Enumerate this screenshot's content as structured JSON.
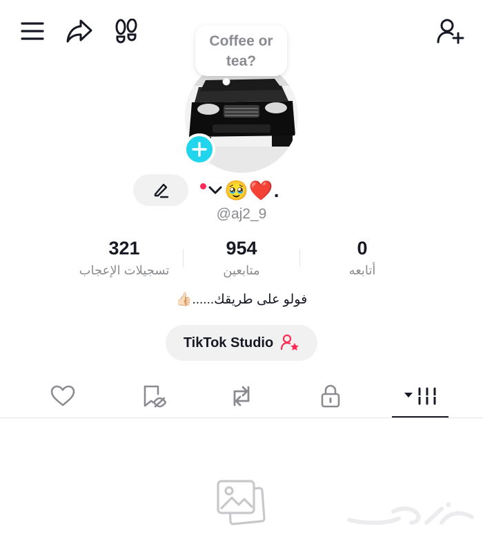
{
  "top_bar": {
    "menu_icon": "hamburger-menu-icon",
    "share_icon": "share-arrow-icon",
    "footprint_icon": "footprints-icon",
    "add_user_icon": "add-user-icon"
  },
  "bubble": {
    "line1": "Coffee or",
    "line2": "tea?"
  },
  "profile": {
    "display_name": "🥹❤️.",
    "username": "@aj2_9",
    "bio": "فولو على طريقك......👍🏻"
  },
  "stats": [
    {
      "value": "0",
      "label": "أتابعه"
    },
    {
      "value": "954",
      "label": "متابعين"
    },
    {
      "value": "321",
      "label": "تسجيلات الإعجاب"
    }
  ],
  "studio": {
    "label": "TikTok Studio"
  },
  "tabs": [
    "videos-grid",
    "private",
    "reposts",
    "favorites",
    "liked"
  ],
  "colors": {
    "accent_cyan": "#20d5ec",
    "accent_red": "#fe2c55",
    "text_primary": "#161823",
    "text_secondary": "#8a8b91"
  }
}
